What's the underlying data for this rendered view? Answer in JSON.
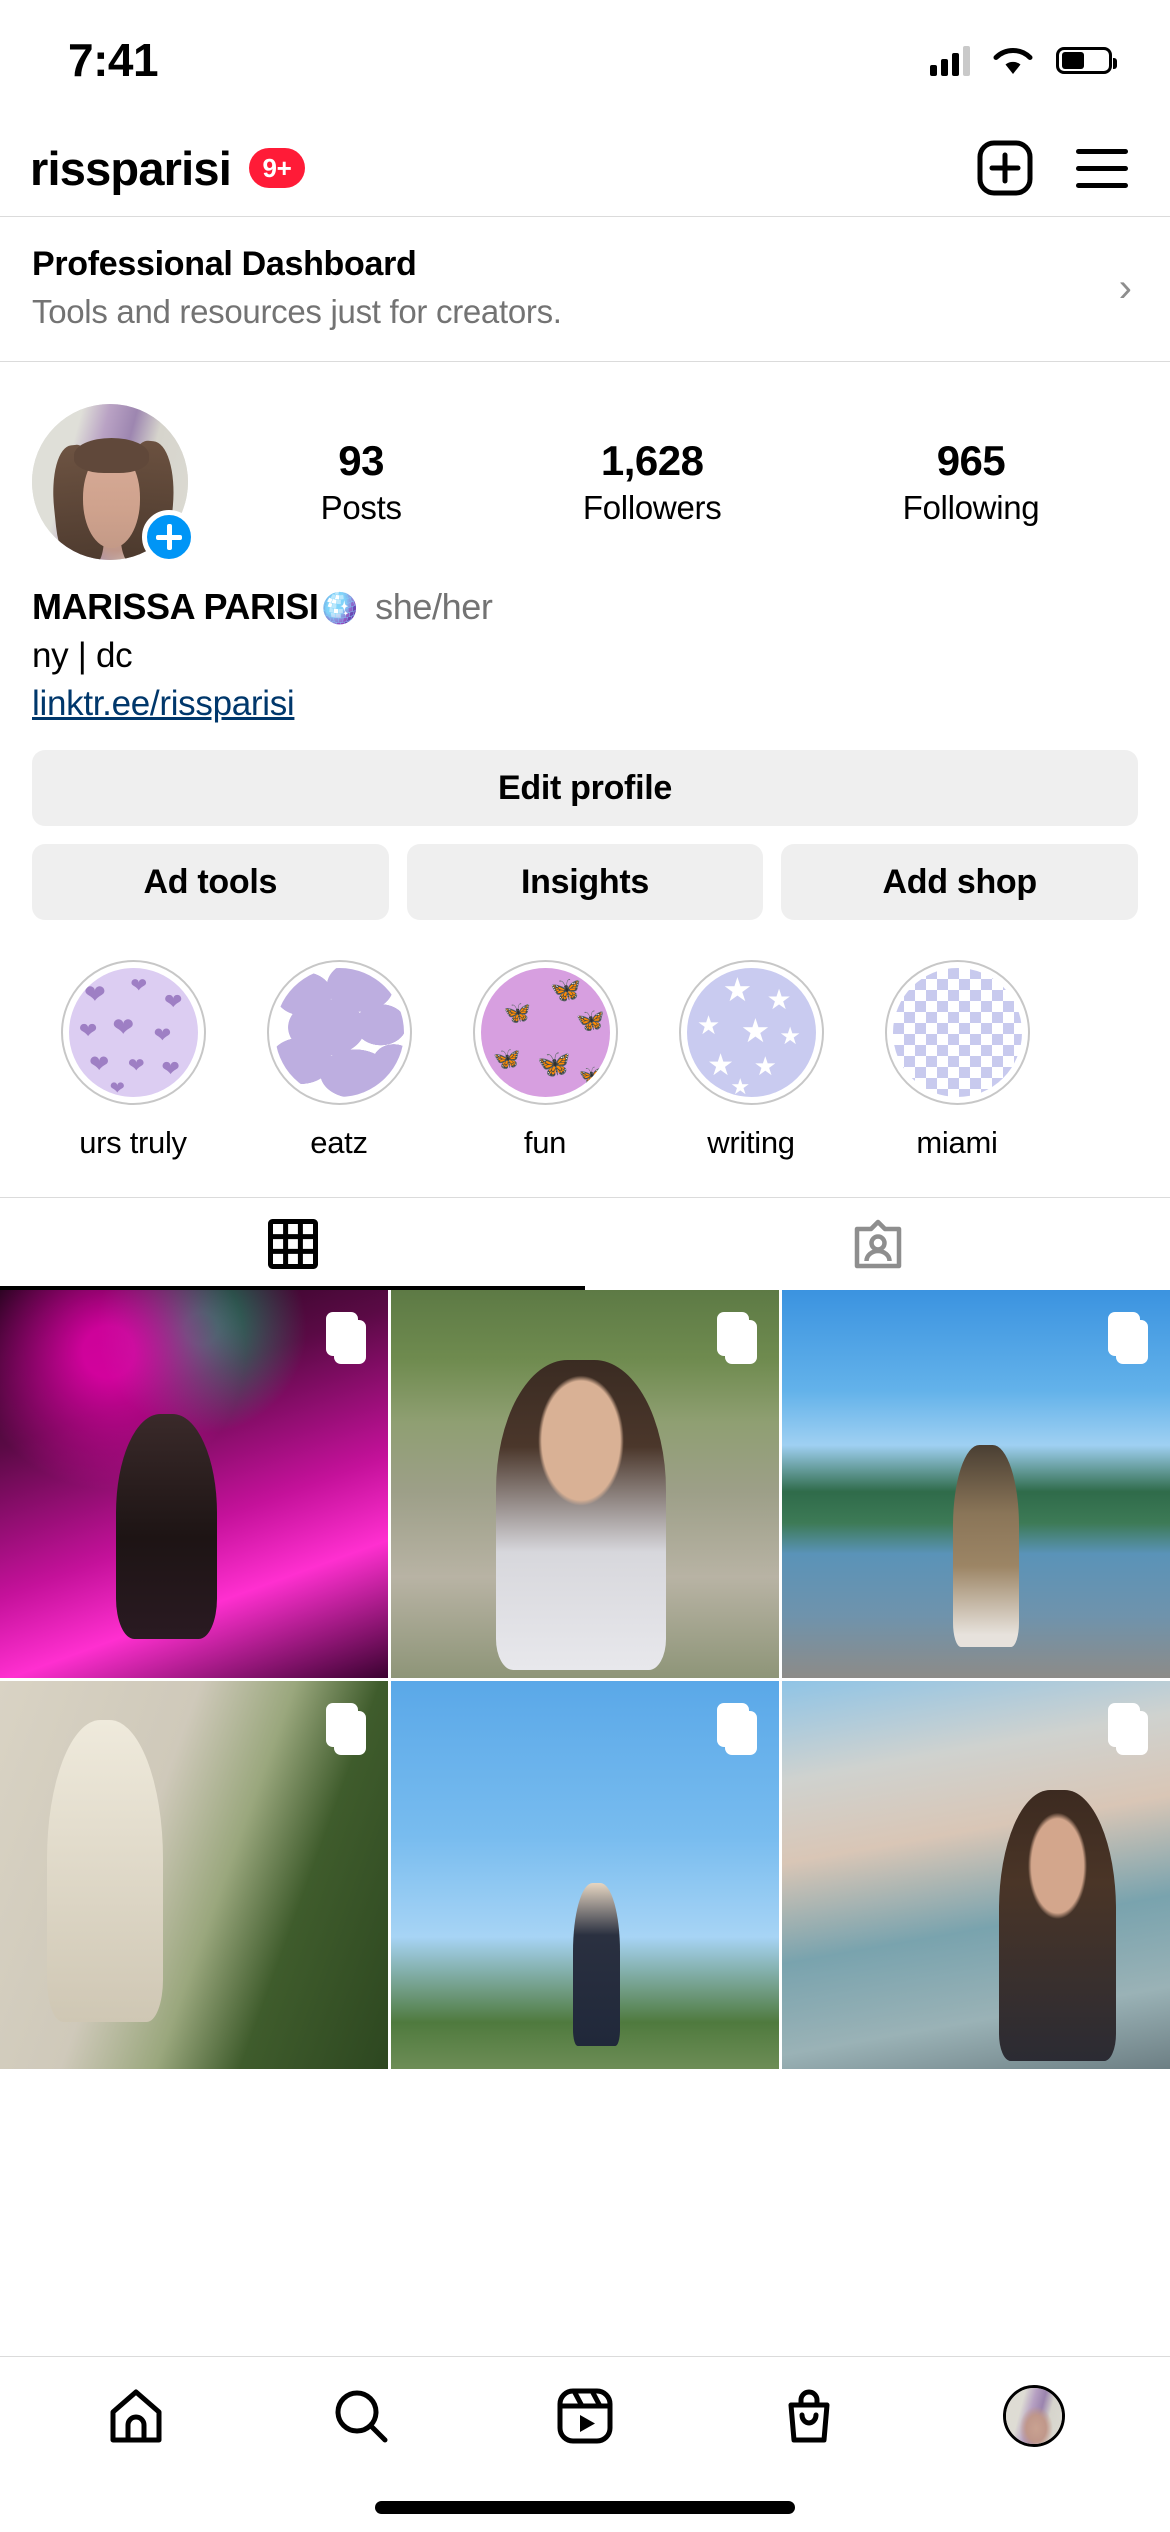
{
  "status_bar": {
    "time": "7:41",
    "cellular_icon": "cellular-signal-icon",
    "wifi_icon": "wifi-icon",
    "battery_icon": "battery-icon",
    "battery_level_percent": 45
  },
  "header": {
    "username": "rissparisi",
    "notification_badge": "9+",
    "badge_color": "#FF1B37",
    "create_icon": "plus-square-icon",
    "menu_icon": "hamburger-menu-icon"
  },
  "professional_dashboard": {
    "title": "Professional Dashboard",
    "subtitle": "Tools and resources just for creators.",
    "chevron": "›"
  },
  "profile": {
    "avatar_name": "profile-avatar",
    "add_story_icon": "plus-icon",
    "stats": [
      {
        "value": "93",
        "label": "Posts"
      },
      {
        "value": "1,628",
        "label": "Followers"
      },
      {
        "value": "965",
        "label": "Following"
      }
    ],
    "display_name": "MARISSA PARISI",
    "name_emoji": "🪩",
    "pronouns": "she/her",
    "bio_line": "ny | dc",
    "link": "linktr.ee/rissparisi",
    "link_color": "#00376B"
  },
  "actions": {
    "edit_profile": "Edit profile",
    "secondary": [
      "Ad tools",
      "Insights",
      "Add shop"
    ]
  },
  "highlights": [
    {
      "label": "urs truly",
      "cover": "hearts"
    },
    {
      "label": "eatz",
      "cover": "cow"
    },
    {
      "label": "fun",
      "cover": "butterfly"
    },
    {
      "label": "writing",
      "cover": "stars"
    },
    {
      "label": "miami",
      "cover": "checker"
    }
  ],
  "tabs": [
    {
      "name": "grid-tab",
      "icon": "grid-icon",
      "active": true
    },
    {
      "name": "tagged-tab",
      "icon": "tagged-person-icon",
      "active": false
    }
  ],
  "grid_posts": [
    {
      "id": 1,
      "is_carousel": true,
      "description": "nightclub pink lights dancing"
    },
    {
      "id": 2,
      "is_carousel": true,
      "description": "selfie white top sidewalk trees"
    },
    {
      "id": 3,
      "is_carousel": true,
      "description": "waterfront railing leopard dress"
    },
    {
      "id": 4,
      "is_carousel": true,
      "description": "statue museum plants"
    },
    {
      "id": 5,
      "is_carousel": true,
      "description": "washington monument blue sky"
    },
    {
      "id": 6,
      "is_carousel": true,
      "description": "cherry blossoms tidal basin"
    }
  ],
  "bottom_nav": [
    {
      "name": "home",
      "icon": "home-icon"
    },
    {
      "name": "search",
      "icon": "search-icon"
    },
    {
      "name": "reels",
      "icon": "reels-icon"
    },
    {
      "name": "shop",
      "icon": "shop-bag-icon"
    },
    {
      "name": "profile",
      "icon": "profile-avatar-icon"
    }
  ]
}
